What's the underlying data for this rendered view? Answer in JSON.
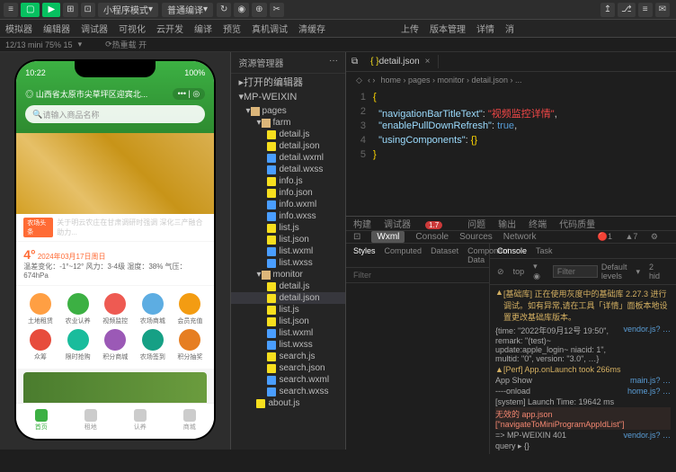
{
  "topbar": {
    "mode": "小程序模式",
    "compile": "普通编译",
    "actions": {
      "compile_btn": "编译",
      "preview": "预览",
      "debug": "真机调试",
      "clear": "清缓存",
      "upload": "上传",
      "version": "版本管理",
      "detail": "详情",
      "msg": "消"
    }
  },
  "tabs": {
    "simulator": "模拟器",
    "editor": "编辑器",
    "debugger": "调试器",
    "visual": "可视化",
    "cloud": "云开发"
  },
  "status": {
    "zoom": "12/13 mini 75% 15",
    "hot": "热重载 开"
  },
  "phone": {
    "time": "10:22",
    "battery": "100%",
    "location": "山西省太原市尖草坪区迎宾北...",
    "search_placeholder": "请输入商品名称",
    "news_tag": "农场头条",
    "news_text": "关于明云农庄在甘肃调研时强调 深化三产融合 助力...",
    "temp": "4°",
    "date": "2024年03月17日周日",
    "weather_detail": "温差变化：-1°~12°  风力：3-4级  湿度：38%  气压：674hPa",
    "grid": [
      "土地租赁",
      "农业认养",
      "视频监控",
      "农场商城",
      "会员充值",
      "众筹",
      "限时抢购",
      "积分商城",
      "农场签到",
      "积分抽奖"
    ],
    "nav": [
      "首页",
      "租地",
      "认养",
      "商城"
    ]
  },
  "explorer": {
    "title": "资源管理器",
    "open_editors": "打开的编辑器",
    "root": "MP-WEIXIN",
    "tree": [
      {
        "n": "pages",
        "t": "fold",
        "d": 1
      },
      {
        "n": "farm",
        "t": "fold",
        "d": 2
      },
      {
        "n": "detail.js",
        "t": "js",
        "d": 3
      },
      {
        "n": "detail.json",
        "t": "json",
        "d": 3
      },
      {
        "n": "detail.wxml",
        "t": "wxml",
        "d": 3
      },
      {
        "n": "detail.wxss",
        "t": "wxss",
        "d": 3
      },
      {
        "n": "info.js",
        "t": "js",
        "d": 3
      },
      {
        "n": "info.json",
        "t": "json",
        "d": 3
      },
      {
        "n": "info.wxml",
        "t": "wxml",
        "d": 3
      },
      {
        "n": "info.wxss",
        "t": "wxss",
        "d": 3
      },
      {
        "n": "list.js",
        "t": "js",
        "d": 3
      },
      {
        "n": "list.json",
        "t": "json",
        "d": 3
      },
      {
        "n": "list.wxml",
        "t": "wxml",
        "d": 3
      },
      {
        "n": "list.wxss",
        "t": "wxss",
        "d": 3
      },
      {
        "n": "monitor",
        "t": "fold",
        "d": 2
      },
      {
        "n": "detail.js",
        "t": "js",
        "d": 3
      },
      {
        "n": "detail.json",
        "t": "json",
        "d": 3,
        "sel": true
      },
      {
        "n": "list.js",
        "t": "js",
        "d": 3
      },
      {
        "n": "list.json",
        "t": "json",
        "d": 3
      },
      {
        "n": "list.wxml",
        "t": "wxml",
        "d": 3
      },
      {
        "n": "list.wxss",
        "t": "wxss",
        "d": 3
      },
      {
        "n": "search.js",
        "t": "js",
        "d": 3
      },
      {
        "n": "search.json",
        "t": "json",
        "d": 3
      },
      {
        "n": "search.wxml",
        "t": "wxml",
        "d": 3
      },
      {
        "n": "search.wxss",
        "t": "wxss",
        "d": 3
      },
      {
        "n": "about.js",
        "t": "js",
        "d": 2
      }
    ]
  },
  "editor": {
    "tab": "detail.json",
    "breadcrumb": [
      "home",
      "pages",
      "monitor",
      "detail.json",
      "..."
    ],
    "lines": [
      "1",
      "2",
      "3",
      "4",
      "5"
    ],
    "json": {
      "k1": "\"navigationBarTitleText\"",
      "v1": "\"视频监控详情\"",
      "k2": "\"enablePullDownRefresh\"",
      "v2": "true",
      "k3": "\"usingComponents\"",
      "v3": "{}"
    }
  },
  "devtools": {
    "tabs": [
      "构建",
      "调试器",
      "问题",
      "输出",
      "终端",
      "代码质量"
    ],
    "badge": "1.7",
    "sub": [
      "Wxml",
      "Console",
      "Sources",
      "Network"
    ],
    "warn_count": "1",
    "err_count": "7",
    "left_tabs": [
      "Styles",
      "Computed",
      "Dataset",
      "Component Data"
    ],
    "filter": "Filter",
    "con_tabs": [
      "Console",
      "Task"
    ],
    "top": "top",
    "filter2": "Filter",
    "levels": "Default levels",
    "hidden": "2 hid",
    "logs": [
      {
        "t": "warn",
        "m": "[基础库] 正在使用灰度中的基础库 2.27.3 进行调试。如有异常,请在工具「详情」面板本地设置更改基础库版本。",
        "s": ""
      },
      {
        "t": "info",
        "m": "{time: \"2022年09月12号 19:50\", remark: \"(test)~ update:apple_login~ niacid: 1\", multid: \"0\", version: \"3.0\", …}",
        "s": "vendor.js? …"
      },
      {
        "t": "warn",
        "m": "[Perf] App.onLaunch took 266ms",
        "s": ""
      },
      {
        "t": "info",
        "m": "App Show",
        "s": "main.js? …"
      },
      {
        "t": "info",
        "m": "----onload",
        "s": "home.js? …"
      },
      {
        "t": "info",
        "m": "[system] Launch Time: 19642 ms",
        "s": ""
      },
      {
        "t": "err",
        "m": "无效的 app.json [\"navigateToMiniProgramAppIdList\"]",
        "s": ""
      },
      {
        "t": "info",
        "m": "=> MP-WEIXIN 401",
        "s": "vendor.js? …"
      },
      {
        "t": "info",
        "m": "query ▸ {}",
        "s": ""
      }
    ]
  }
}
